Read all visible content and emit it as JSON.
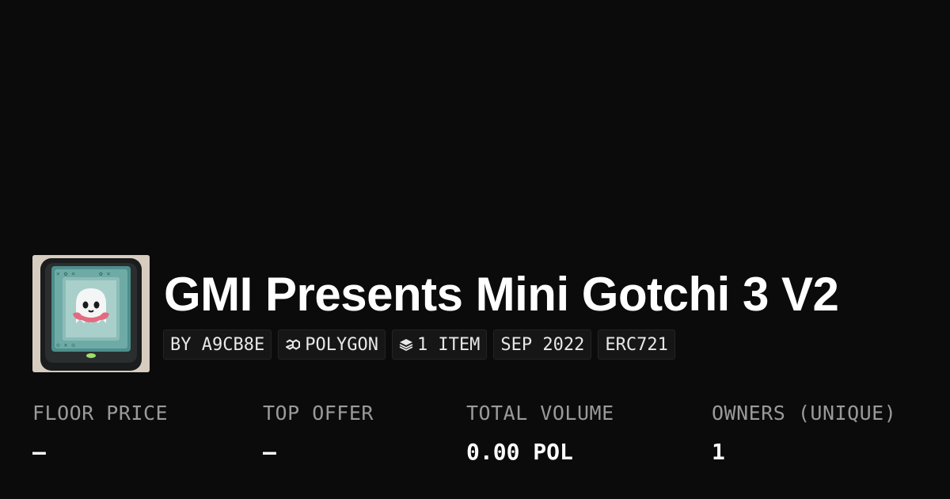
{
  "collection": {
    "title": "GMI Presents Mini Gotchi 3 V2",
    "thumbnail_icon": "ghost-in-frame-artwork"
  },
  "chips": {
    "creator": "BY A9CB8E",
    "chain": "POLYGON",
    "chain_icon": "polygon-icon",
    "items": "1 ITEM",
    "items_icon": "layers-icon",
    "date": "SEP 2022",
    "standard": "ERC721"
  },
  "stats": {
    "floor_price": {
      "label": "FLOOR PRICE",
      "value": "–"
    },
    "top_offer": {
      "label": "TOP OFFER",
      "value": "–"
    },
    "total_volume": {
      "label": "TOTAL VOLUME",
      "value": "0.00 POL"
    },
    "owners": {
      "label": "OWNERS (UNIQUE)",
      "value": "1"
    }
  },
  "colors": {
    "background": "#0b0b0b",
    "chip_background": "#161616",
    "label_gray": "#9a9a9a",
    "text": "#ffffff"
  }
}
